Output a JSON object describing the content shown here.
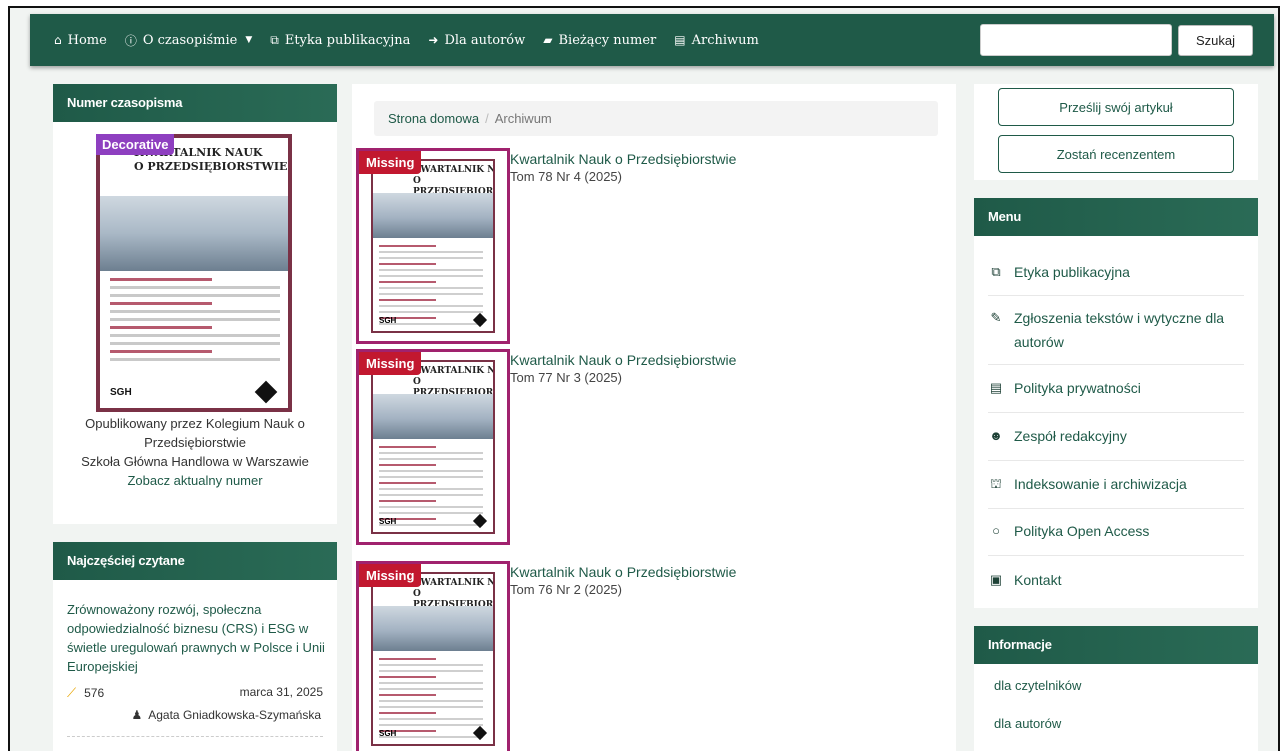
{
  "nav": {
    "items": [
      {
        "icon": "home-icon",
        "glyph": "🏠",
        "label": "Home"
      },
      {
        "icon": "info-icon",
        "glyph": "ℹ",
        "label": "O czasopiśmie",
        "dropdown": true
      },
      {
        "icon": "copy-icon",
        "glyph": "⧉",
        "label": "Etyka publikacyjna"
      },
      {
        "icon": "sign-in-icon",
        "glyph": "➜",
        "label": "Dla autorów"
      },
      {
        "icon": "book-icon",
        "glyph": "📖",
        "label": "Bieżący numer"
      },
      {
        "icon": "archive-icon",
        "glyph": "▦",
        "label": "Archiwum"
      }
    ],
    "search_value": "",
    "search_button": "Szukaj"
  },
  "issue_panel": {
    "heading": "Numer czasopisma",
    "badge": "Decorative",
    "cover_title_line1": "KWARTALNIK NAUK",
    "cover_title_line2": "O PRZEDSIĘBIORSTWIE",
    "cover_publisher": "SGH",
    "published_by": "Opublikowany przez Kolegium Nauk o Przedsiębiorstwie",
    "school": "Szkoła Główna Handlowa w Warszawie",
    "current_issue_link": "Zobacz aktualny numer"
  },
  "most_read": {
    "heading": "Najczęściej czytane",
    "article_title": "Zrównoważony rozwój, społeczna odpowiedzialność biznesu (CRS) i ESG w świetle uregulowań prawnych w Polsce i Unii Europejskiej",
    "views": "576",
    "date": "marca 31, 2025",
    "author": "Agata Gniadkowska-Szymańska"
  },
  "breadcrumb": {
    "home": "Strona domowa",
    "separator": "/",
    "current": "Archiwum"
  },
  "issues": [
    {
      "badge": "Missing",
      "title": "Kwartalnik Nauk o Przedsiębiorstwie",
      "subtitle": "Tom 78 Nr 4 (2025)"
    },
    {
      "badge": "Missing",
      "title": "Kwartalnik Nauk o Przedsiębiorstwie",
      "subtitle": "Tom 77 Nr 3 (2025)"
    },
    {
      "badge": "Missing",
      "title": "Kwartalnik Nauk o Przedsiębiorstwie",
      "subtitle": "Tom 76 Nr 2 (2025)"
    }
  ],
  "thumb_cover": {
    "line1": "KWARTALNIK NAUK",
    "line2": "O PRZEDSIĘBIORSTWIE",
    "publisher": "SGH"
  },
  "actions": {
    "submit": "Prześlij swój artykuł",
    "reviewer": "Zostań recenzentem"
  },
  "menu": {
    "heading": "Menu",
    "items": [
      {
        "icon": "copy-icon",
        "glyph": "⧉",
        "label": "Etyka publikacyjna"
      },
      {
        "icon": "edit-icon",
        "glyph": "✎",
        "label": "Zgłoszenia tekstów i wytyczne dla autorów"
      },
      {
        "icon": "file-icon",
        "glyph": "🗎",
        "label": "Polityka prywatności"
      },
      {
        "icon": "users-icon",
        "glyph": "👥",
        "label": "Zespół redakcyjny"
      },
      {
        "icon": "sitemap-icon",
        "glyph": "⛫",
        "label": "Indeksowanie i archiwizacja"
      },
      {
        "icon": "circle-icon",
        "glyph": "○",
        "label": "Polityka Open Access"
      },
      {
        "icon": "address-card-icon",
        "glyph": "▣",
        "label": "Kontakt"
      }
    ]
  },
  "info": {
    "heading": "Informacje",
    "readers": "dla czytelników",
    "authors": "dla autorów"
  },
  "colors": {
    "brand": "#1f5a48",
    "cover_border": "#7a3146",
    "badge_decorative": "#8e3fc0",
    "badge_missing": "#c2182f",
    "thumb_border": "#a0226e"
  }
}
